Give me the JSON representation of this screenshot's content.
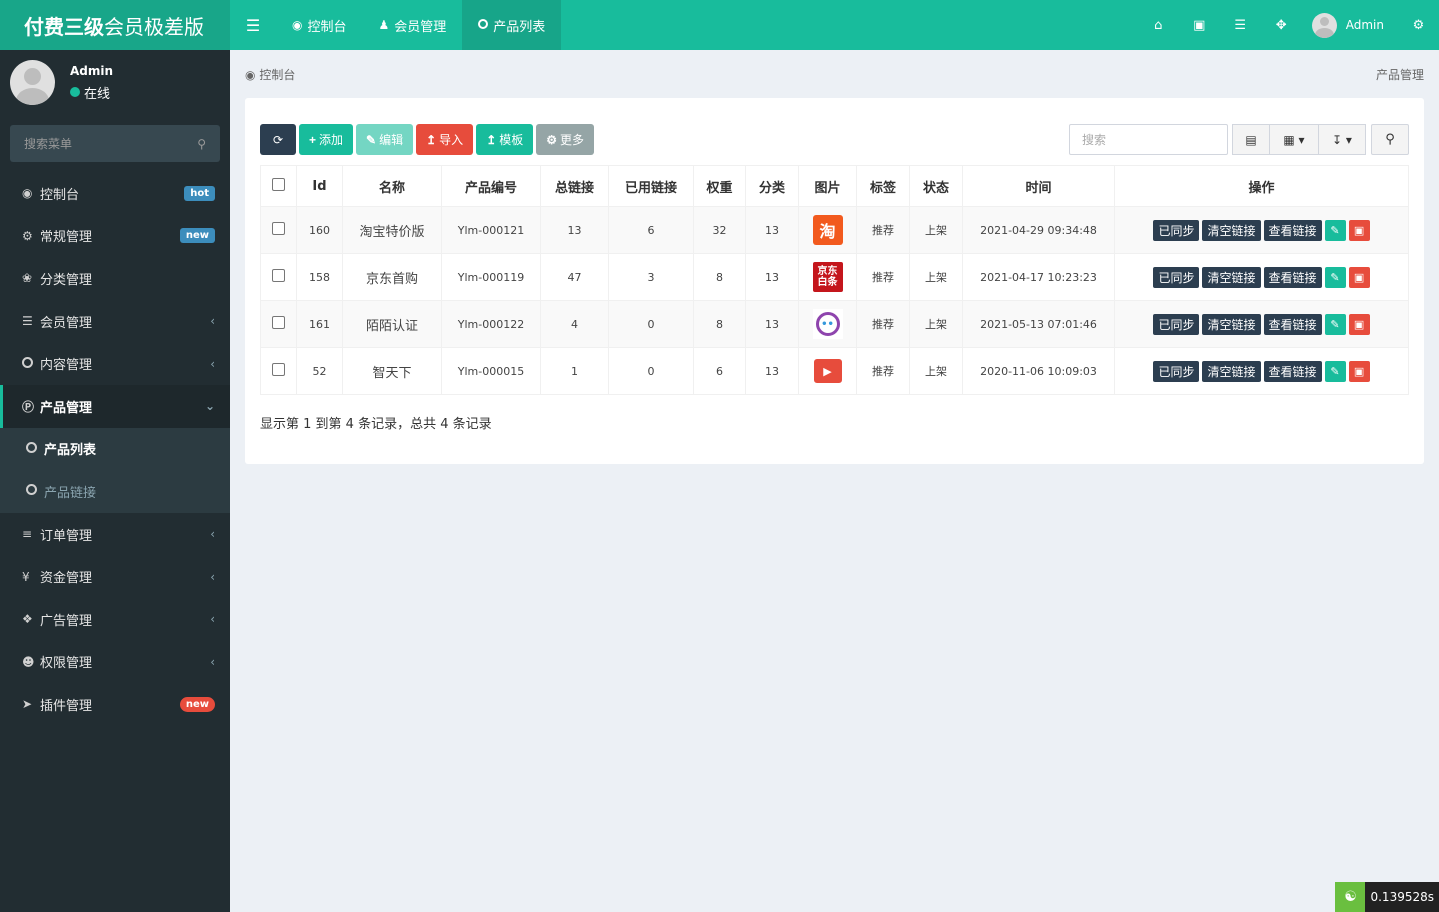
{
  "brand": {
    "bold": "付费三级",
    "rest": "会员极差版"
  },
  "user": {
    "name": "Admin",
    "status": "在线"
  },
  "sidebar": {
    "search_placeholder": "搜索菜单",
    "items": [
      {
        "label": "控制台",
        "badge": "hot"
      },
      {
        "label": "常规管理",
        "badge": "new"
      },
      {
        "label": "分类管理"
      },
      {
        "label": "会员管理"
      },
      {
        "label": "内容管理"
      },
      {
        "label": "产品管理"
      },
      {
        "label": "产品列表"
      },
      {
        "label": "产品链接"
      },
      {
        "label": "订单管理"
      },
      {
        "label": "资金管理"
      },
      {
        "label": "广告管理"
      },
      {
        "label": "权限管理"
      },
      {
        "label": "插件管理",
        "badge": "new"
      }
    ]
  },
  "navbar": {
    "tabs": [
      {
        "label": "控制台"
      },
      {
        "label": "会员管理"
      },
      {
        "label": "产品列表"
      }
    ],
    "user": "Admin"
  },
  "breadcrumb": {
    "left": "控制台",
    "right": "产品管理"
  },
  "toolbar": {
    "add": "添加",
    "edit": "编辑",
    "import": "导入",
    "template": "模板",
    "more": "更多",
    "search_placeholder": "搜索"
  },
  "table": {
    "headers": [
      "Id",
      "名称",
      "产品编号",
      "总链接",
      "已用链接",
      "权重",
      "分类",
      "图片",
      "标签",
      "状态",
      "时间",
      "操作"
    ],
    "rows": [
      {
        "id": "160",
        "name": "淘宝特价版",
        "code": "Ylm-000121",
        "total": "13",
        "used": "6",
        "weight": "32",
        "cat": "13",
        "img": "淘",
        "tag": "推荐",
        "status": "上架",
        "time": "2021-04-29 09:34:48"
      },
      {
        "id": "158",
        "name": "京东首购",
        "code": "Ylm-000119",
        "total": "47",
        "used": "3",
        "weight": "8",
        "cat": "13",
        "img_line1": "京东",
        "img_line2": "白条",
        "tag": "推荐",
        "status": "上架",
        "time": "2021-04-17 10:23:23"
      },
      {
        "id": "161",
        "name": "陌陌认证",
        "code": "Ylm-000122",
        "total": "4",
        "used": "0",
        "weight": "8",
        "cat": "13",
        "tag": "推荐",
        "status": "上架",
        "time": "2021-05-13 07:01:46"
      },
      {
        "id": "52",
        "name": "智天下",
        "code": "Ylm-000015",
        "total": "1",
        "used": "0",
        "weight": "6",
        "cat": "13",
        "tag": "推荐",
        "status": "上架",
        "time": "2020-11-06 10:09:03"
      }
    ],
    "ops": {
      "sync": "已同步",
      "clear": "清空链接",
      "view": "查看链接"
    }
  },
  "pager": "显示第 1 到第 4 条记录，总共 4 条记录",
  "timer": "0.139528s",
  "colors": {
    "accent": "#18bc9c",
    "sidebar": "#222d32",
    "danger": "#e74c3c",
    "dark": "#2c3e50"
  }
}
